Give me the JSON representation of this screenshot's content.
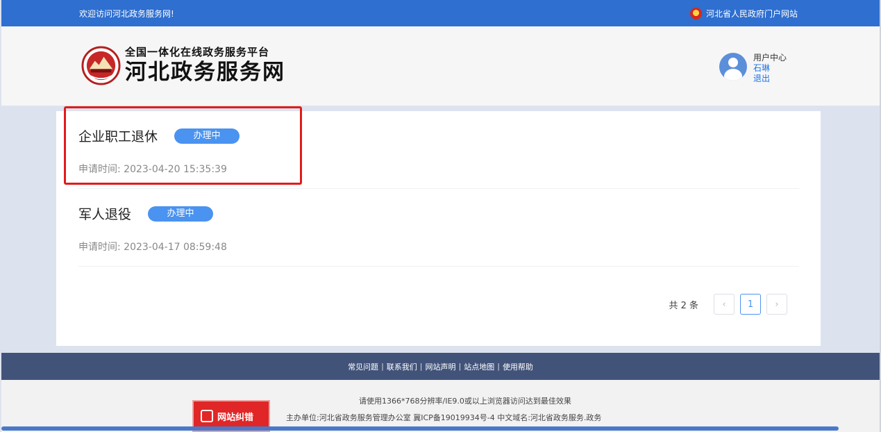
{
  "topbar": {
    "welcome": "欢迎访问河北政务服务网!",
    "gov_link": "河北省人民政府门户网站",
    "gov_icon": "national-emblem-icon"
  },
  "header": {
    "logo_sub": "全国一体化在线政务服务平台",
    "logo_main": "河北政务服务网",
    "logo_icon": "hebei-emblem-logo"
  },
  "user": {
    "center_label": "用户中心",
    "name": "石琳",
    "logout_label": "退出",
    "avatar_icon": "user-avatar-icon"
  },
  "records": [
    {
      "title": "企业职工退休",
      "status": "办理中",
      "time_label": "申请时间:",
      "time": "2023-04-20 15:35:39"
    },
    {
      "title": "军人退役",
      "status": "办理中",
      "time_label": "申请时间:",
      "time": "2023-04-17 08:59:48"
    }
  ],
  "pager": {
    "total_text": "共 2 条",
    "prev": "‹",
    "current_page": "1",
    "next": "›"
  },
  "footer_nav": [
    "常见问题",
    "联系我们",
    "网站声明",
    "站点地图",
    "使用帮助"
  ],
  "footer": {
    "line1": "请使用1366*768分辨率/IE9.0或以上浏览器访问达到最佳效果",
    "line2": "主办单位:河北省政务服务管理办公室   冀ICP备19019934号-4   中文域名:河北省政务服务.政务",
    "report_button": "网站纠错"
  },
  "colors": {
    "topbar": "#2e6fd0",
    "badge": "#4a93f0",
    "highlight": "#e21b1b",
    "footer_nav": "#42537a"
  }
}
